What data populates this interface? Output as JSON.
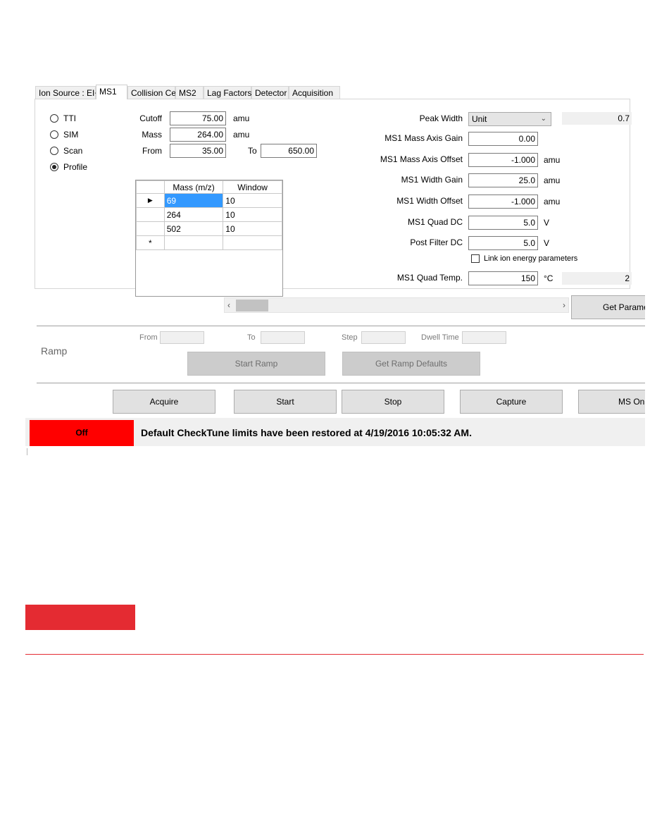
{
  "tabs": [
    "Ion Source : EI+",
    "MS1",
    "Collision Cell",
    "MS2",
    "Lag Factors",
    "Detector",
    "Acquisition"
  ],
  "active_tab": "MS1",
  "scan_modes": [
    {
      "label": "TTI",
      "selected": false
    },
    {
      "label": "SIM",
      "selected": false
    },
    {
      "label": "Scan",
      "selected": false
    },
    {
      "label": "Profile",
      "selected": true
    }
  ],
  "left_fields": {
    "cutoff_label": "Cutoff",
    "cutoff_value": "75.00",
    "cutoff_unit": "amu",
    "mass_label": "Mass",
    "mass_value": "264.00",
    "mass_unit": "amu",
    "from_label": "From",
    "from_value": "35.00",
    "to_label": "To",
    "to_value": "650.00"
  },
  "mass_table": {
    "headers": [
      "Mass (m/z)",
      "Window"
    ],
    "rows": [
      {
        "mass": "69",
        "window": "10",
        "row_marker": "▶"
      },
      {
        "mass": "264",
        "window": "10",
        "row_marker": ""
      },
      {
        "mass": "502",
        "window": "10",
        "row_marker": ""
      }
    ],
    "new_row_marker": "*"
  },
  "right_fields": {
    "peak_width_label": "Peak Width",
    "peak_width_value": "Unit",
    "peak_width_readout": "0.7",
    "mass_axis_gain_label": "MS1 Mass Axis Gain",
    "mass_axis_gain_value": "0.00",
    "mass_axis_offset_label": "MS1 Mass Axis Offset",
    "mass_axis_offset_value": "-1.000",
    "mass_axis_offset_unit": "amu",
    "width_gain_label": "MS1 Width Gain",
    "width_gain_value": "25.0",
    "width_gain_unit": "amu",
    "width_offset_label": "MS1 Width Offset",
    "width_offset_value": "-1.000",
    "width_offset_unit": "amu",
    "quad_dc_label": "MS1 Quad DC",
    "quad_dc_value": "5.0",
    "quad_dc_unit": "V",
    "post_filter_label": "Post Filter DC",
    "post_filter_value": "5.0",
    "post_filter_unit": "V",
    "link_ion_label": "Link ion energy parameters",
    "link_ion_checked": false,
    "quad_temp_label": "MS1 Quad Temp.",
    "quad_temp_value": "150",
    "quad_temp_unit": "°C",
    "quad_temp_readout": "2"
  },
  "scrollbar": {
    "left_arrow": "‹",
    "right_arrow": "›"
  },
  "get_params_button": "Get Paramete",
  "ramp": {
    "title": "Ramp",
    "from_label": "From",
    "to_label": "To",
    "step_label": "Step",
    "dwell_label": "Dwell Time",
    "from_value": "",
    "to_value": "",
    "step_value": "",
    "dwell_value": "",
    "start_ramp": "Start Ramp",
    "get_ramp_defaults": "Get Ramp Defaults"
  },
  "actions": [
    "Acquire",
    "Start",
    "Stop",
    "Capture",
    "MS On"
  ],
  "status": {
    "state": "Off",
    "state_color": "#ff0000",
    "message": "Default CheckTune limits have been restored at 4/19/2016 10:05:32 AM."
  },
  "colors": {
    "accent_red": "#e42b32",
    "selection_blue": "#3399ff"
  }
}
